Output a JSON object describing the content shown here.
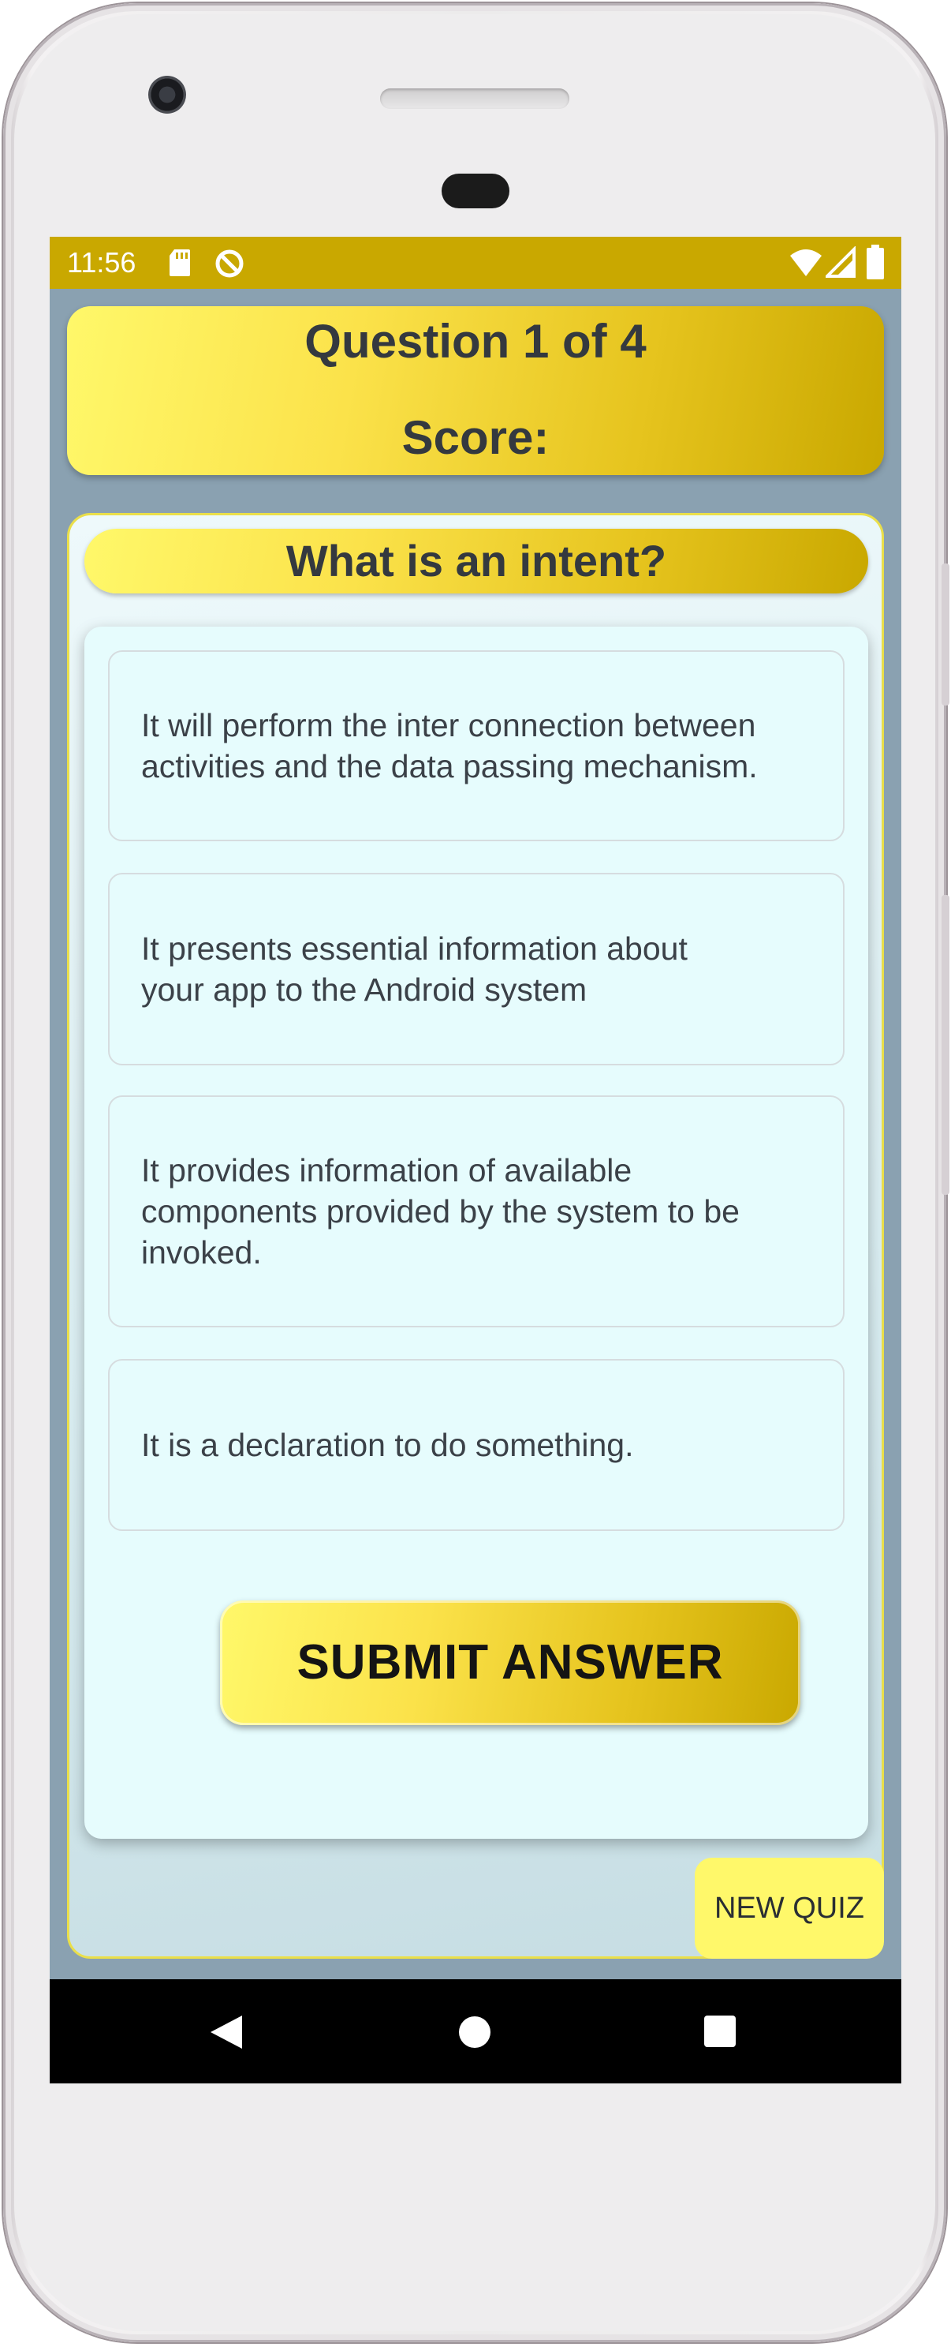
{
  "status_bar": {
    "time": "11:56",
    "left_icons": [
      "sd-card-icon",
      "sync-disabled-icon"
    ],
    "right_icons": [
      "wifi-icon",
      "cell-signal-icon",
      "battery-icon"
    ],
    "color": "#c9a800"
  },
  "header": {
    "question_progress": "Question 1 of 4",
    "score_label": "Score:"
  },
  "question": {
    "text": "What is an intent?"
  },
  "options": [
    {
      "line1": "It will perform the inter connection between",
      "line2": "activities and the data passing mechanism.",
      "line3": ""
    },
    {
      "line1": "It presents essential information about",
      "line2": "your app to the Android system",
      "line3": ""
    },
    {
      "line1": "It provides information of available",
      "line2": "components provided by the system to be",
      "line3": "invoked."
    },
    {
      "line1": "It is a declaration to do something.",
      "line2": "",
      "line3": ""
    }
  ],
  "actions": {
    "submit_label": "SUBMIT ANSWER",
    "new_quiz_label": "NEW QUIZ"
  },
  "navigation": {
    "icons": [
      "back-icon",
      "home-icon",
      "recents-icon"
    ]
  },
  "colors": {
    "accent_yellow": "#fff86a",
    "accent_gold": "#c9a800",
    "background": "#8aa1b1",
    "card": "#e6fcfd"
  }
}
